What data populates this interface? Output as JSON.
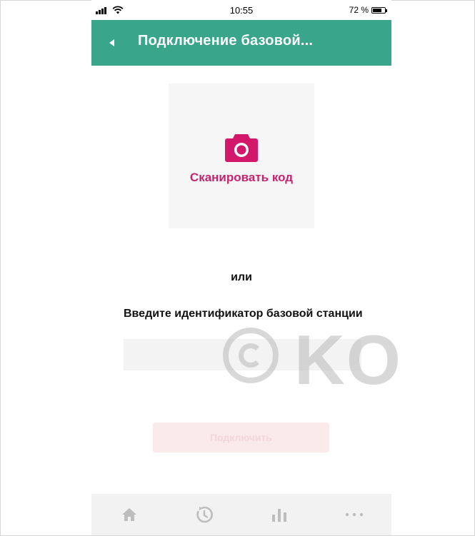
{
  "status_bar": {
    "time": "10:55",
    "battery": "72 %",
    "battery_level": 0.72
  },
  "header": {
    "title": "Подключение базовой...",
    "back_icon": "back-arrow-icon",
    "background": "#39a68b"
  },
  "scan": {
    "label": "Сканировать код",
    "icon": "camera-icon",
    "accent": "#c5256e"
  },
  "or_text": "или",
  "station_id": {
    "label": "Введите идентификатор базовой станции",
    "value": "",
    "placeholder": ""
  },
  "connect_button": {
    "label": "Подключить",
    "enabled": false
  },
  "watermark": {
    "text": "KO"
  },
  "bottom_nav": [
    {
      "icon": "home-icon"
    },
    {
      "icon": "history-icon"
    },
    {
      "icon": "stats-icon"
    },
    {
      "icon": "more-icon"
    }
  ]
}
